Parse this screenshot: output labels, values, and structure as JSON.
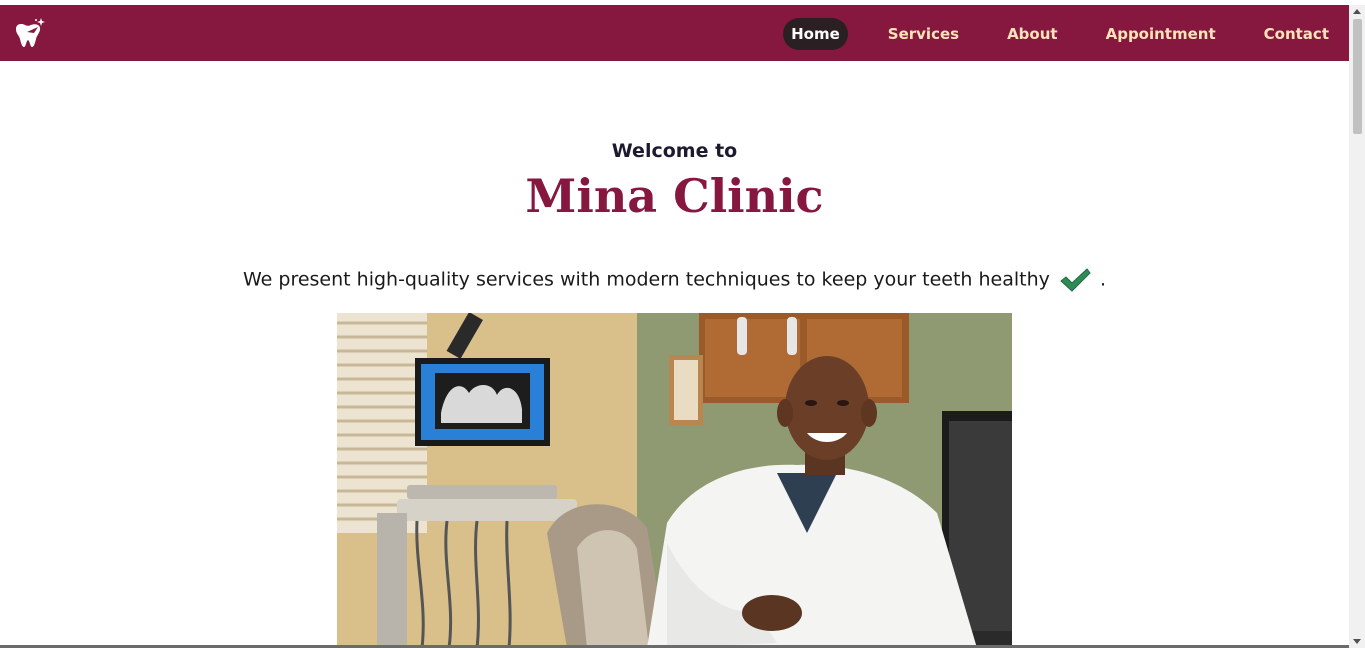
{
  "nav": {
    "logo_icon": "tooth-sparkle-icon",
    "links": [
      {
        "label": "Home",
        "active": true
      },
      {
        "label": "Services",
        "active": false
      },
      {
        "label": "About",
        "active": false
      },
      {
        "label": "Appointment",
        "active": false
      },
      {
        "label": "Contact",
        "active": false
      }
    ]
  },
  "hero": {
    "welcome": "Welcome to",
    "clinic_name": "Mina Clinic",
    "tagline": "We present high-quality services with modern techniques to keep your teeth healthy",
    "tagline_end": ".",
    "check_icon": "check-mark-icon",
    "image": "dentist-photo"
  },
  "colors": {
    "brand": "#861840",
    "nav_text": "#fbe3b8",
    "active_pill": "#2a2024",
    "check": "#2e8b57"
  }
}
